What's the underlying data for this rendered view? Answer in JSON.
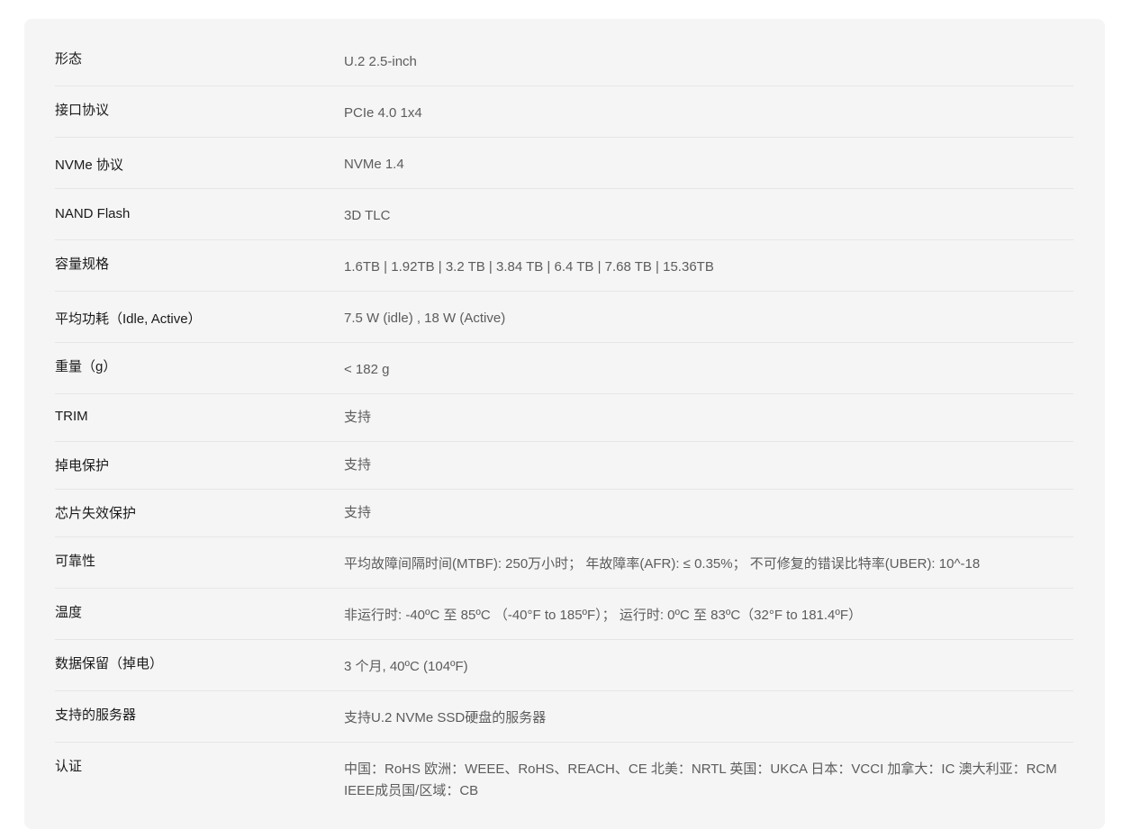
{
  "specs": [
    {
      "label": "形态",
      "value": "U.2 2.5-inch"
    },
    {
      "label": "接口协议",
      "value": "PCIe 4.0 1x4"
    },
    {
      "label": "NVMe 协议",
      "value": "NVMe 1.4"
    },
    {
      "label": "NAND Flash",
      "value": "3D TLC"
    },
    {
      "label": "容量规格",
      "value": "1.6TB | 1.92TB | 3.2 TB | 3.84 TB | 6.4 TB | 7.68 TB | 15.36TB"
    },
    {
      "label": "平均功耗（Idle, Active）",
      "value": "7.5 W (idle) , 18 W (Active)"
    },
    {
      "label": "重量（g）",
      "value": "< 182 g"
    },
    {
      "label": "TRIM",
      "value": "支持"
    },
    {
      "label": "掉电保护",
      "value": "支持"
    },
    {
      "label": "芯片失效保护",
      "value": "支持"
    },
    {
      "label": "可靠性",
      "value": "平均故障间隔时间(MTBF): 250万小时；  年故障率(AFR): ≤ 0.35%；  不可修复的错误比特率(UBER): 10^-18"
    },
    {
      "label": "温度",
      "value": "非运行时: -40ºC 至 85ºC （-40°F to 185ºF）；  运行时: 0ºC 至 83ºC（32°F to 181.4ºF）"
    },
    {
      "label": "数据保留（掉电）",
      "value": "3 个月, 40ºC (104ºF)"
    },
    {
      "label": "支持的服务器",
      "value": "支持U.2 NVMe SSD硬盘的服务器"
    },
    {
      "label": "认证",
      "value": "中国：RoHS 欧洲：WEEE、RoHS、REACH、CE 北美：NRTL 英国：UKCA 日本：VCCI 加拿大：IC 澳大利亚：RCM IEEE成员国/区域：CB"
    }
  ]
}
